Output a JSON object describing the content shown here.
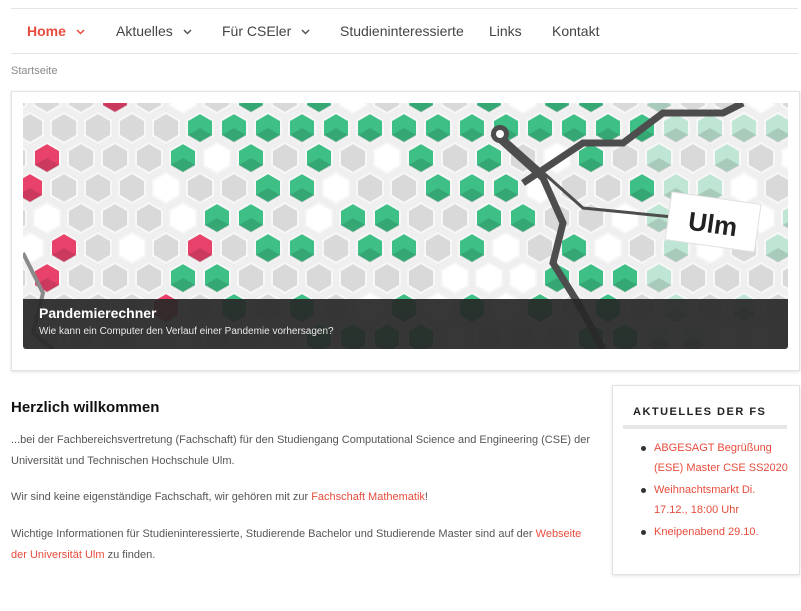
{
  "nav": {
    "items": [
      {
        "label": "Home",
        "dropdown": true,
        "active": true
      },
      {
        "label": "Aktuelles",
        "dropdown": true
      },
      {
        "label": "Für CSEler",
        "dropdown": true
      },
      {
        "label": "Studieninteressierte",
        "dropdown": false
      },
      {
        "label": "Links",
        "dropdown": false
      },
      {
        "label": "Kontakt",
        "dropdown": false
      }
    ]
  },
  "breadcrumb": "Startseite",
  "hero": {
    "title": "Pandemierechner",
    "subtitle": "Wie kann ein Computer den Verlauf einer Pandemie vorhersagen?",
    "map_label": "Ulm"
  },
  "main": {
    "heading": "Herzlich willkommen",
    "p1": "...bei der Fachbereichsvertretung (Fachschaft) für den Studiengang Computational Science and Engineering (CSE) der Universität und Technischen Hochschule Ulm.",
    "p2_text": "Wir sind keine eigenständige Fachschaft, wir gehören mit zur ",
    "p2_link": "Fachschaft Mathematik",
    "p2_end": "!",
    "p3_text": "Wichtige Informationen für Studieninteressierte, Studierende Bachelor und Studierende Master sind auf der ",
    "p3_link": "Webseite der Universität Ulm",
    "p3_end": " zu finden."
  },
  "widget": {
    "title": "AKTUELLES DER FS",
    "items": [
      "ABGESAGT Begrüßung (ESE) Master CSE SS2020",
      "Weihnachtsmarkt Di. 17.12., 18:00 Uhr",
      "Kneipenabend 29.10."
    ]
  },
  "colors": {
    "accent": "#e74c3c",
    "hero_green": "#3dbf86",
    "hero_pink": "#e8426b",
    "hero_grey": "#d9d9d9"
  }
}
